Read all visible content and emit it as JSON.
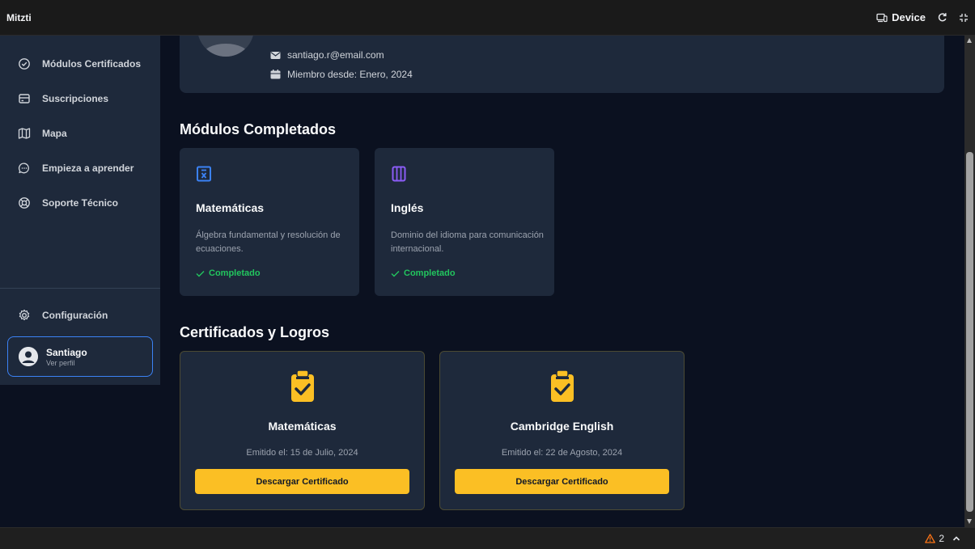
{
  "app": {
    "title": "Mitzti"
  },
  "toolbar": {
    "device_label": "Device"
  },
  "sidebar": {
    "items": [
      {
        "label": "Módulos Certificados",
        "icon": "check-circle-icon"
      },
      {
        "label": "Suscripciones",
        "icon": "credit-card-icon"
      },
      {
        "label": "Mapa",
        "icon": "map-icon"
      },
      {
        "label": "Empieza a aprender",
        "icon": "chat-bubble-icon"
      },
      {
        "label": "Soporte Técnico",
        "icon": "lifebuoy-icon"
      }
    ],
    "settings_label": "Configuración",
    "profile": {
      "name": "Santiago",
      "subtitle": "Ver perfil"
    }
  },
  "profile": {
    "email": "santiago.r@email.com",
    "member_since": "Miembro desde: Enero, 2024"
  },
  "modules": {
    "title": "Módulos Completados",
    "items": [
      {
        "title": "Matemáticas",
        "description": "Álgebra fundamental y resolución de ecuaciones.",
        "status": "Completado",
        "icon": "calculator-icon",
        "color": "#3b82f6"
      },
      {
        "title": "Inglés",
        "description": "Dominio del idioma para comunicación internacional.",
        "status": "Completado",
        "icon": "book-icon",
        "color": "#8b5cf6"
      }
    ]
  },
  "certificates": {
    "title": "Certificados y Logros",
    "items": [
      {
        "title": "Matemáticas",
        "issued": "Emitido el: 15 de Julio, 2024",
        "button": "Descargar Certificado"
      },
      {
        "title": "Cambridge English",
        "issued": "Emitido el: 22 de Agosto, 2024",
        "button": "Descargar Certificado"
      }
    ]
  },
  "statusbar": {
    "warning_count": "2"
  },
  "colors": {
    "accent": "#3b82f6",
    "success": "#22c55e",
    "certificate": "#fbbf24",
    "warning": "#f97316"
  }
}
